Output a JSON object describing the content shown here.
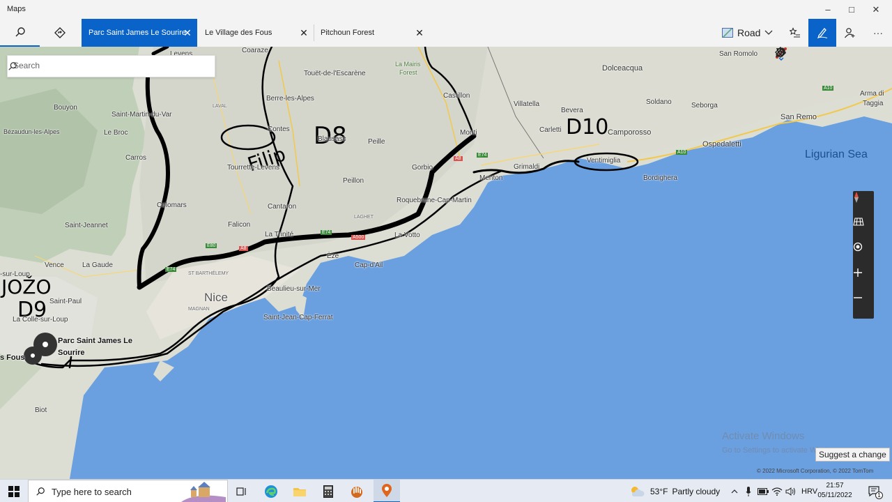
{
  "window": {
    "title": "Maps",
    "minimize": "–",
    "maximize": "□",
    "close": "✕"
  },
  "tabs": [
    {
      "label": "Parc Saint James Le Sourire",
      "active": true
    },
    {
      "label": "Le Village des Fous",
      "active": false
    },
    {
      "label": "Pitchoun Forest",
      "active": false
    }
  ],
  "tab_close": "✕",
  "toolbar": {
    "map_style": "Road",
    "more": "···"
  },
  "search": {
    "placeholder": "Search"
  },
  "map_labels": {
    "nice": "Nice",
    "ligurian_sea": "Ligurian Sea",
    "parc_saint_james": "Parc Saint James Le Sourire",
    "parc_line1": "Parc Saint James Le",
    "parc_line2": "Sourire",
    "s_fous": "s Fous",
    "coaraze": "Coaraze",
    "lavena": "Levens",
    "touet": "Touët-de-l'Escarène",
    "la_mairis": "La Mairis",
    "forest": "Forest",
    "castillon": "Castillon",
    "san_romolo": "San Romolo",
    "dolceacqua": "Dolceacqua",
    "arma": "Arma di",
    "taggia": "Taggia",
    "bouyon": "Bouyon",
    "st_martin": "Saint-Martin-du-Var",
    "laval": "LAVAL",
    "berre": "Berre-les-Alpes",
    "villatella": "Villatella",
    "bevera": "Bevera",
    "soldano": "Soldano",
    "seborga": "Seborga",
    "bezaudun": "Bézaudun-les-Alpes",
    "le_broc": "Le Broc",
    "contes": "Contes",
    "blausasc": "Blausasc",
    "peille": "Peille",
    "monti": "Monti",
    "carletti": "Carletti",
    "camporosso": "Camporosso",
    "san_remo": "San Remo",
    "carros": "Carros",
    "tourrette": "Tourrette-Levens",
    "ventimiglia": "Ventimiglia",
    "gorbio": "Gorbio",
    "grimaldi": "Grimaldi",
    "ospedaletti": "Ospedaletti",
    "bordighera": "Bordighera",
    "peillon": "Peillon",
    "menton": "Menton",
    "colomars": "Colomars",
    "cantaron": "Cantaron",
    "roquebrune": "Roquebrune-Cap-Martin",
    "saint_jeannet": "Saint-Jeannet",
    "falicon": "Falicon",
    "laghet": "LAGHET",
    "la_trinite": "La Trinité",
    "la_votto": "La Votto",
    "vence": "Vence",
    "la_gaude": "La Gaude",
    "sur_loup": "-sur-Loup",
    "st_barthelemy": "ST BARTHÉLEMY",
    "eze": "Èze",
    "cap_dail": "Cap-d'Ail",
    "beaulieu": "Beaulieu-sur-Mer",
    "saint_paul": "Saint-Paul",
    "magnan": "MAGNAN",
    "st_jean": "Saint-Jean-Cap-Ferrat",
    "la_colle": "La Colle-sur-Loup",
    "biot": "Biot",
    "e80": "E80",
    "e74": "E74",
    "a8": "A8",
    "a500": "A500",
    "a10": "A10"
  },
  "ink_annotations": {
    "filip": "Filip",
    "d8": "D8",
    "d10": "D10",
    "jozo": "JOŽO",
    "d9": "D9"
  },
  "watermark": {
    "line1": "Activate Windows",
    "line2": "Go to Settings to activate Windows."
  },
  "suggest_change": "Suggest a change",
  "copyright": "© 2022 Microsoft Corporation, © 2022 TomTom",
  "taskbar": {
    "search_placeholder": "Type here to search",
    "weather_temp": "53°F",
    "weather_desc": "Partly cloudy",
    "language": "HRV",
    "time": "21:57",
    "date": "05/11/2022",
    "notification_count": "1"
  },
  "colors": {
    "accent": "#0a63c9",
    "sea": "#6a9fe0",
    "land": "#d6dcd0",
    "ink": "#000000"
  }
}
